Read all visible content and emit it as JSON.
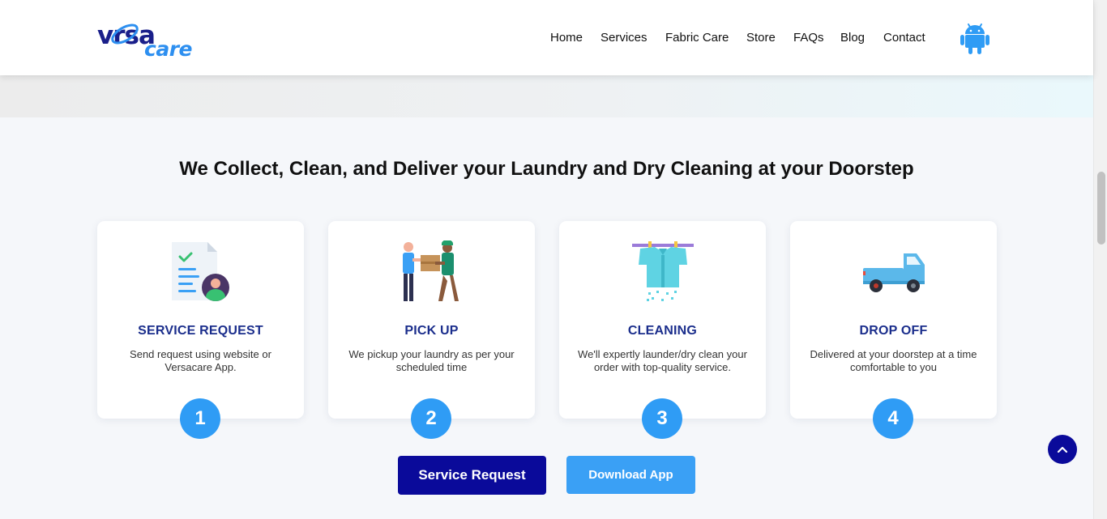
{
  "header": {
    "logo": {
      "text_top": "vrsa",
      "text_bottom": "care"
    },
    "nav": [
      {
        "label": "Home"
      },
      {
        "label": "Services"
      },
      {
        "label": "Fabric Care"
      },
      {
        "label": "Store"
      },
      {
        "label": "FAQs"
      },
      {
        "label": "Blog"
      },
      {
        "label": "Contact"
      }
    ],
    "app_icon": "android-icon"
  },
  "section": {
    "headline": "We Collect, Clean, and Deliver your Laundry and Dry Cleaning at your Doorstep",
    "steps": [
      {
        "icon": "document-user-icon",
        "title": "SERVICE REQUEST",
        "description": "Send request using website or Versacare App.",
        "number": "1"
      },
      {
        "icon": "delivery-handover-icon",
        "title": "PICK UP",
        "description": "We pickup your laundry as per your scheduled time",
        "number": "2"
      },
      {
        "icon": "washed-shirt-icon",
        "title": "CLEANING",
        "description": "We'll expertly launder/dry clean your order with top-quality service.",
        "number": "3"
      },
      {
        "icon": "pickup-truck-icon",
        "title": "DROP OFF",
        "description": "Delivered at your doorstep at a time comfortable to you",
        "number": "4"
      }
    ],
    "buttons": {
      "primary": "Service Request",
      "secondary": "Download App"
    }
  },
  "back_to_top_icon": "chevron-up-icon",
  "colors": {
    "brand_dark": "#0a0a9a",
    "brand_light": "#3aa0f5",
    "title_blue": "#1b2e8c",
    "step_circle": "#2f9cf5"
  }
}
